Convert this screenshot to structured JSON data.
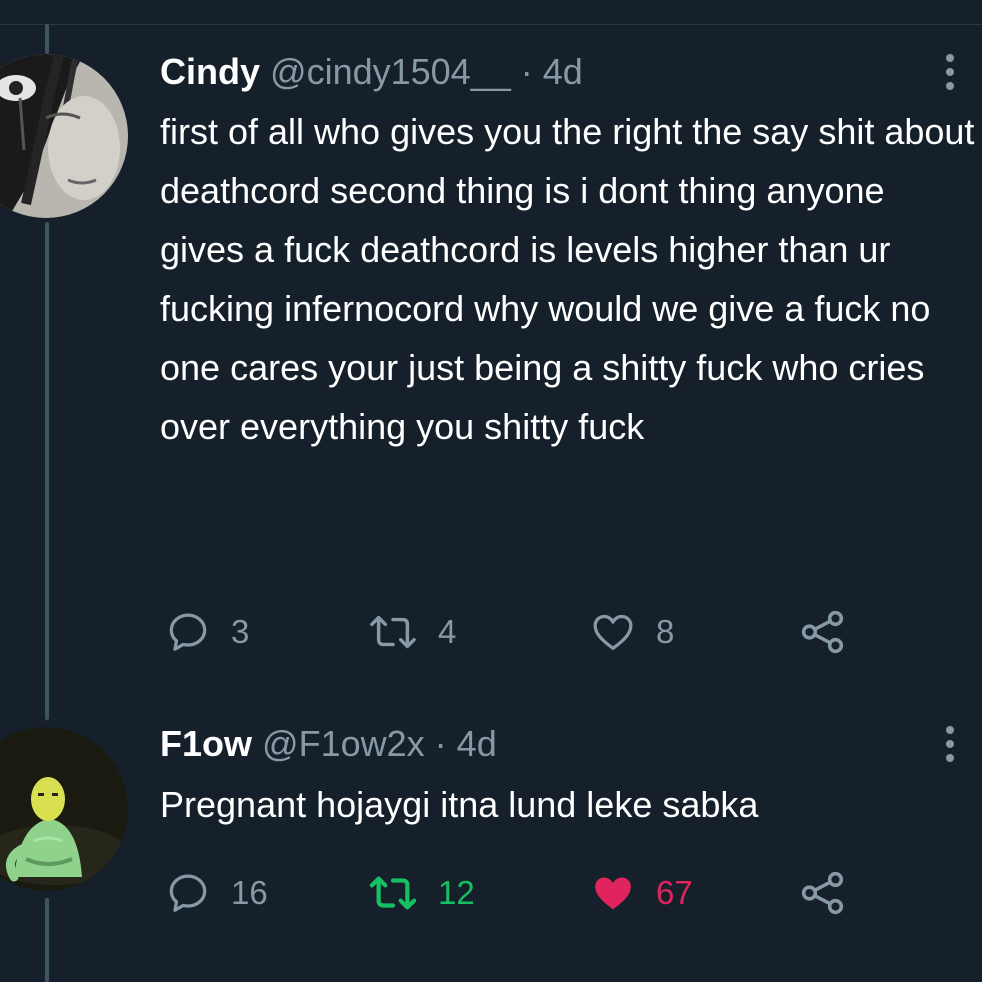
{
  "tweets": [
    {
      "name": "Cindy",
      "handle": "@cindy1504__",
      "separator": "·",
      "time": "4d",
      "text": "first of all who gives you the right the say shit about deathcord second thing is i dont thing anyone gives a fuck deathcord is levels higher than ur fucking infernocord why would we give a fuck no one cares your just being a shitty fuck who cries over everything you shitty fuck",
      "replies": "3",
      "retweets": "4",
      "likes": "8",
      "icons": {
        "reply": "reply-icon",
        "retweet": "retweet-icon",
        "like": "heart-outline-icon",
        "share": "share-icon",
        "more": "more-vertical-icon"
      }
    },
    {
      "name": "F1ow",
      "handle": "@F1ow2x",
      "separator": "·",
      "time": "4d",
      "text": "Pregnant hojaygi itna lund leke sabka",
      "replies": "16",
      "retweets": "12",
      "likes": "67",
      "retweeted": true,
      "liked": true,
      "icons": {
        "reply": "reply-icon",
        "retweet": "retweet-icon",
        "like": "heart-filled-icon",
        "share": "share-icon",
        "more": "more-vertical-icon"
      }
    }
  ],
  "colors": {
    "background": "#15202b",
    "secondary_text": "#8899a6",
    "retweet_active": "#17bf63",
    "like_active": "#e0245e",
    "thread_line": "#3d5466"
  }
}
